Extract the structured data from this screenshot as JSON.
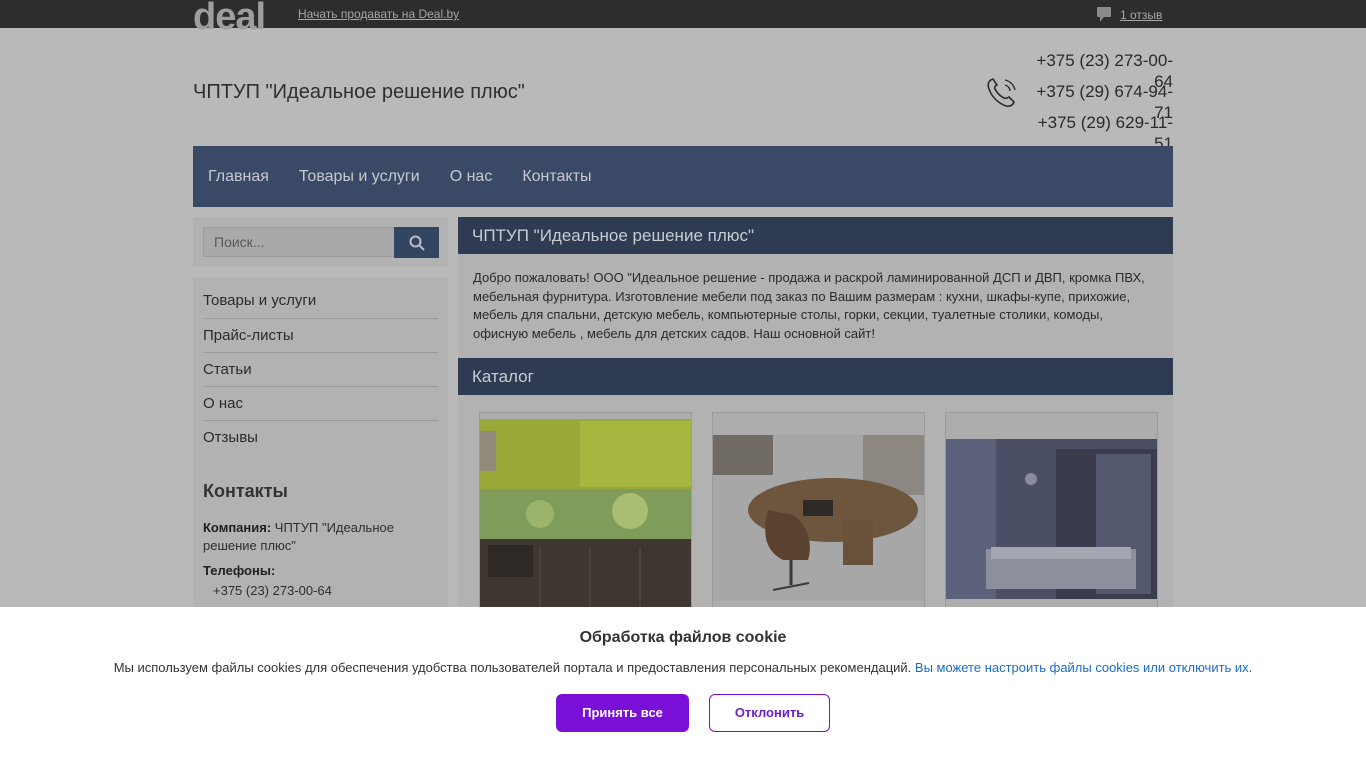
{
  "topbar": {
    "logo": "deal",
    "sell_link": "Начать продавать на Deal.by",
    "reviews": "1 отзыв"
  },
  "header": {
    "company_title": "ЧПТУП \"Идеальное решение плюс\"",
    "phones": [
      "+375 (23) 273-00-64",
      "+375 (29) 674-94-71",
      "+375 (29) 629-11-51"
    ]
  },
  "nav": {
    "items": [
      "Главная",
      "Товары и услуги",
      "О нас",
      "Контакты"
    ]
  },
  "search": {
    "placeholder": "Поиск..."
  },
  "sidebar": {
    "items": [
      "Товары и услуги",
      "Прайс-листы",
      "Статьи",
      "О нас",
      "Отзывы"
    ],
    "contacts_title": "Контакты",
    "company_label": "Компания:",
    "company_value": "ЧПТУП \"Идеальное решение плюс\"",
    "phones_label": "Телефоны:",
    "phone": "+375 (23) 273-00-64"
  },
  "main": {
    "title": "ЧПТУП \"Идеальное решение плюс\"",
    "intro": "Добро пожаловать! ООО \"Идеальное решение - продажа и раскрой ламинированной ДСП и ДВП, кромка ПВХ, мебельная фурнитура. Изготовление мебели под заказ по Вашим размерам : кухни, шкафы-купе, прихожие, мебель для спальни, детскую мебель, компьютерные столы, горки, секции, туалетные столики, комоды, офисную мебель , мебель для детских садов. Наш основной сайт!",
    "catalog_title": "Каталог"
  },
  "cookie": {
    "title": "Обработка файлов cookie",
    "text": "Мы используем файлы cookies для обеспечения удобства пользователей портала и предоставления персональных рекомендаций.",
    "link": "Вы можете настроить файлы cookies или отключить их.",
    "accept": "Принять все",
    "decline": "Отклонить"
  },
  "colors": {
    "nav_bg": "#3a4a66",
    "head_bg": "#2f3b52",
    "accept_bg": "#7a10d8",
    "link": "#1a6cc4"
  }
}
